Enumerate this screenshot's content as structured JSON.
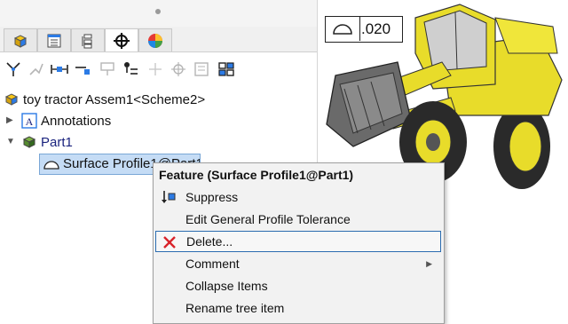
{
  "tree": {
    "assembly_label": "toy tractor Assem1<Scheme2>",
    "annotations_label": "Annotations",
    "part_label": "Part1",
    "feature_label": "Surface Profile1@Part1"
  },
  "tolerance": {
    "value": ".020"
  },
  "context_menu": {
    "header": "Feature (Surface Profile1@Part1)",
    "items": [
      {
        "label": "Suppress"
      },
      {
        "label": "Edit General Profile Tolerance"
      },
      {
        "label": "Delete..."
      },
      {
        "label": "Comment"
      },
      {
        "label": "Collapse Items"
      },
      {
        "label": "Rename tree item"
      }
    ]
  },
  "colors": {
    "selection": "#c5dcf5",
    "delete_icon": "#d9232a",
    "part_text": "#1a237e",
    "tractor_body": "#e8dc2a"
  },
  "icons": [
    "part-tab-icon",
    "property-tab-icon",
    "config-tab-icon",
    "dimxpert-tab-icon",
    "display-tab-icon",
    "suppress-icon",
    "delete-icon"
  ]
}
